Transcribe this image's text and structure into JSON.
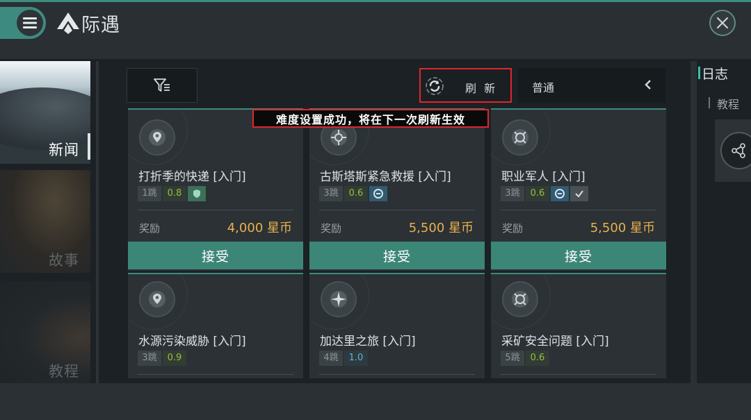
{
  "header": {
    "title": "际遇",
    "menu_icon": "hamburger-menu-icon",
    "logo_icon": "diamond-emblem-icon",
    "close_icon": "close-icon"
  },
  "sidebar": {
    "tabs": [
      {
        "label": "新闻",
        "active": true
      },
      {
        "label": "故事",
        "active": false
      },
      {
        "label": "教程",
        "active": false
      }
    ]
  },
  "toolbar": {
    "filter_icon": "filter-icon",
    "refresh_label": "刷 新",
    "difficulty_value": "普通"
  },
  "toast": {
    "message": "难度设置成功，将在下一次刷新生效"
  },
  "missions": [
    {
      "title": "打折季的快递 [入门]",
      "jumps": "1跳",
      "security": "0.8",
      "security_color": "green",
      "faction": "green",
      "reward_label": "奖励",
      "reward": "4,000 星币",
      "accept": "接受"
    },
    {
      "title": "古斯塔斯紧急救援 [入门]",
      "jumps": "3跳",
      "security": "0.6",
      "security_color": "green",
      "faction": "blue",
      "reward_label": "奖励",
      "reward": "5,500 星币",
      "accept": "接受"
    },
    {
      "title": "职业军人 [入门]",
      "jumps": "3跳",
      "security": "0.6",
      "security_color": "green",
      "faction": "blue-check",
      "reward_label": "奖励",
      "reward": "5,500 星币",
      "accept": "接受"
    },
    {
      "title": "水源污染威胁 [入门]",
      "jumps": "3跳",
      "security": "0.9",
      "security_color": "green"
    },
    {
      "title": "加达里之旅 [入门]",
      "jumps": "4跳",
      "security": "1.0",
      "security_color": "blue"
    },
    {
      "title": "采矿安全问题 [入门]",
      "jumps": "5跳",
      "security": "0.6",
      "security_color": "green"
    }
  ],
  "right_panel": {
    "log_title": "日志",
    "tutorial_label": "教程",
    "node_icon": "network-nodes-icon"
  },
  "colors": {
    "accent": "#3c8678",
    "reward": "#e9b14d",
    "highlight": "#e0262b"
  }
}
